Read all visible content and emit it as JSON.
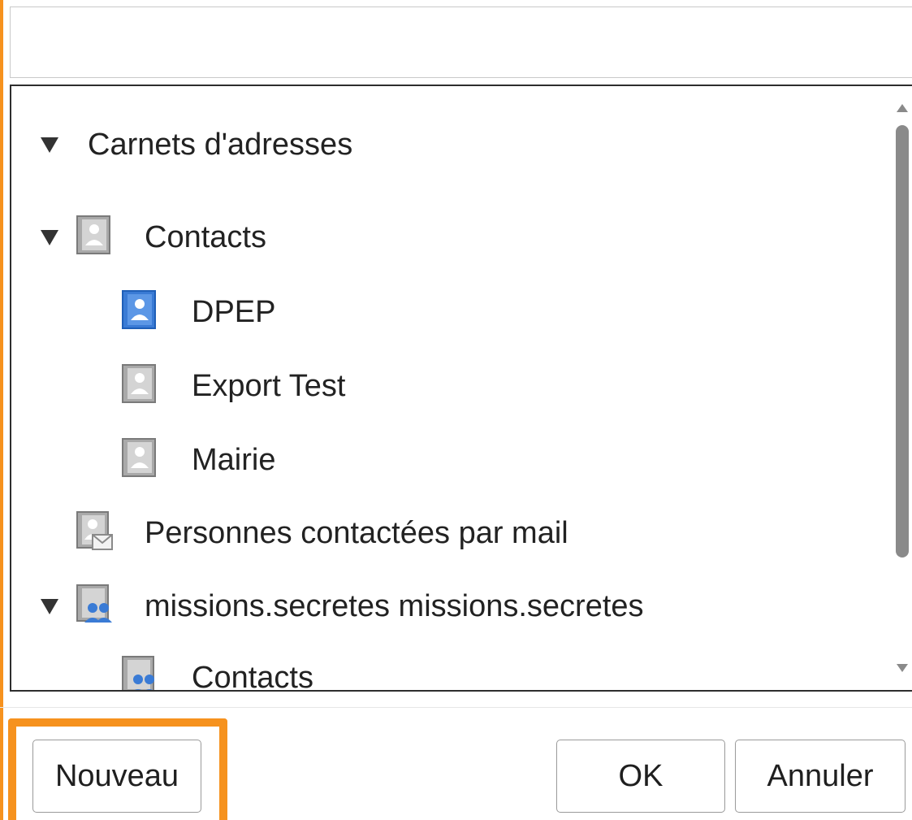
{
  "search": {
    "value": "",
    "placeholder": ""
  },
  "tree": {
    "root_label": "Carnets d'adresses",
    "items": [
      {
        "label": "Contacts",
        "icon": "address-book-icon",
        "expanded": true
      },
      {
        "label": "DPEP",
        "icon": "address-book-blue-icon"
      },
      {
        "label": "Export Test",
        "icon": "address-book-icon"
      },
      {
        "label": "Mairie",
        "icon": "address-book-icon"
      },
      {
        "label": "Personnes contactées par mail",
        "icon": "collected-addresses-icon"
      },
      {
        "label": "missions.secretes missions.secretes",
        "icon": "shared-book-icon",
        "expanded": true
      },
      {
        "label": "Contacts",
        "icon": "shared-book-icon"
      }
    ]
  },
  "buttons": {
    "new": "Nouveau",
    "ok": "OK",
    "cancel": "Annuler"
  },
  "colors": {
    "highlight": "#f6921e",
    "selected_icon": "#3a7bd5",
    "scroll_thumb": "#8a8a8a"
  }
}
